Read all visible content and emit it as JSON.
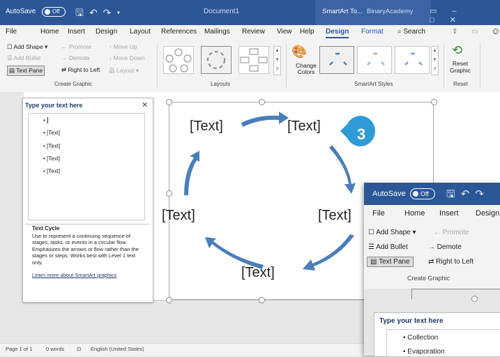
{
  "titlebar": {
    "autosave": "AutoSave",
    "toggle": "Off",
    "doc_title": "Document1",
    "context_tab": "SmartArt To...",
    "user": "BinaryAcademy"
  },
  "menu": [
    "File",
    "Home",
    "Insert",
    "Design",
    "Layout",
    "References",
    "Mailings",
    "Review",
    "View",
    "Help",
    "Design",
    "Format"
  ],
  "search": "Search",
  "ribbon": {
    "add_shape": "Add Shape",
    "add_bullet": "Add Bullet",
    "text_pane": "Text Pane",
    "promote": "Promote",
    "demote": "Demote",
    "right_to_left": "Right to Left",
    "move_up": "Move Up",
    "move_down": "Move Down",
    "layout": "Layout",
    "change_colors": "Change Colors",
    "reset_graphic": "Reset Graphic",
    "groups": {
      "create_graphic": "Create Graphic",
      "layouts": "Layouts",
      "styles": "SmartArt Styles",
      "reset": "Reset"
    }
  },
  "text_pane": {
    "title": "Type your text here",
    "bullets": [
      "",
      "[Text]",
      "[Text]",
      "[Text]",
      "[Text]"
    ],
    "desc_title": "Text Cycle",
    "desc_body": "Use to represent a continuing sequence of stages, tasks, or events in a circular flow. Emphasizes the arrows or flow rather than the stages or steps. Works best with Level 1 text only.",
    "learn_more": "Learn more about SmartArt graphics"
  },
  "smartart": {
    "labels": [
      "[Text]",
      "[Text]",
      "[Text]",
      "[Text]",
      "[Text]"
    ]
  },
  "badge": "3",
  "status": {
    "page": "Page 1 of 1",
    "words": "0 words",
    "lang": "English (United States)"
  },
  "inset": {
    "autosave": "AutoSave",
    "toggle": "Off",
    "menu": [
      "File",
      "Home",
      "Insert",
      "Design"
    ],
    "add_shape": "Add Shape",
    "promote": "Promote",
    "add_bullet": "Add Bullet",
    "demote": "Demote",
    "text_pane": "Text Pane",
    "right_to_left": "Right to Left",
    "group": "Create Graphic",
    "pane_title": "Type your text here",
    "bullets": [
      "Collection",
      "Evaporation"
    ]
  },
  "colors": {
    "accent": "#2b5797",
    "arrow": "#4a7ebb",
    "badge": "#2e9bd6"
  }
}
